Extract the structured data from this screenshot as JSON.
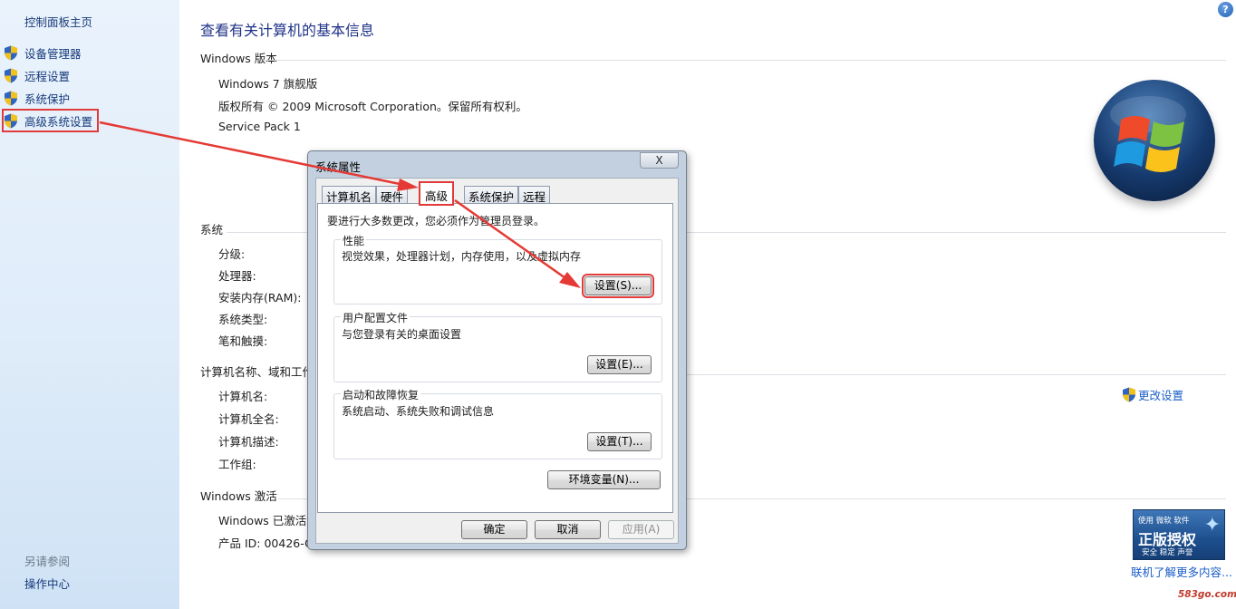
{
  "nav": {
    "home": "控制面板主页",
    "items": [
      {
        "label": "设备管理器"
      },
      {
        "label": "远程设置"
      },
      {
        "label": "系统保护"
      },
      {
        "label": "高级系统设置"
      }
    ],
    "see_also": "另请参阅",
    "action_center": "操作中心"
  },
  "main": {
    "title": "查看有关计算机的基本信息",
    "edition": {
      "header": "Windows 版本",
      "name": "Windows 7 旗舰版",
      "copyright": "版权所有 © 2009 Microsoft Corporation。保留所有权利。",
      "service_pack": "Service Pack 1"
    },
    "system": {
      "header": "系统",
      "rating": "分级:",
      "processor": "处理器:",
      "ram": "安装内存(RAM):",
      "type": "系统类型:",
      "pen": "笔和触摸:"
    },
    "computer": {
      "header": "计算机名称、域和工作组设置",
      "name": "计算机名:",
      "full_name": "计算机全名:",
      "description": "计算机描述:",
      "workgroup": "工作组:",
      "change_settings": "更改设置"
    },
    "activation": {
      "header": "Windows 激活",
      "status": "Windows 已激活",
      "product_id": "产品 ID: 00426-O"
    },
    "genuine": {
      "badge_top": "使用 微软 软件",
      "badge_main": "正版授权",
      "badge_bottom": "安全 稳定 声誉",
      "link": "联机了解更多内容..."
    },
    "watermark": "583go.com"
  },
  "dialog": {
    "title": "系统属性",
    "close": "X",
    "tabs": [
      {
        "label": "计算机名"
      },
      {
        "label": "硬件"
      },
      {
        "label": "高级"
      },
      {
        "label": "系统保护"
      },
      {
        "label": "远程"
      }
    ],
    "active_tab": "高级",
    "admin_note": "要进行大多数更改，您必须作为管理员登录。",
    "performance": {
      "title": "性能",
      "desc": "视觉效果，处理器计划，内存使用，以及虚拟内存",
      "button": "设置(S)..."
    },
    "profiles": {
      "title": "用户配置文件",
      "desc": "与您登录有关的桌面设置",
      "button": "设置(E)..."
    },
    "startup": {
      "title": "启动和故障恢复",
      "desc": "系统启动、系统失败和调试信息",
      "button": "设置(T)..."
    },
    "env_button": "环境变量(N)...",
    "ok": "确定",
    "cancel": "取消",
    "apply": "应用(A)"
  },
  "colors": {
    "highlight": "#e03a3a",
    "link": "#1b5ec8",
    "title": "#1e3287"
  }
}
